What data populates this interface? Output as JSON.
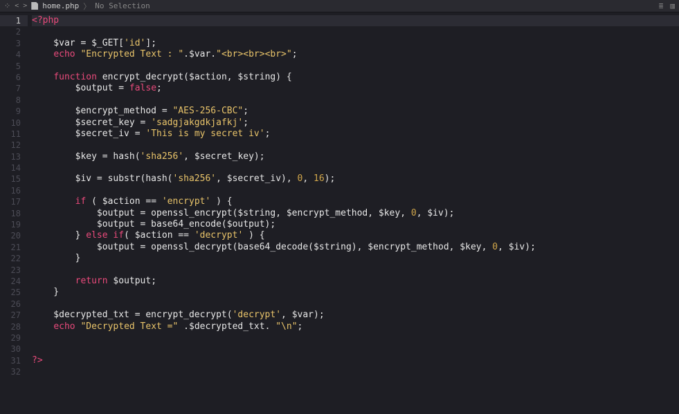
{
  "topbar": {
    "file_name": "home.php",
    "selection": "No Selection",
    "separator": "〉"
  },
  "active_line": 1,
  "lines": [
    [
      {
        "c": "t-tag",
        "t": "<?php"
      }
    ],
    [],
    [
      {
        "c": "t-misc",
        "t": "    $var = $_GET["
      },
      {
        "c": "t-idx",
        "t": "'id'"
      },
      {
        "c": "t-misc",
        "t": "];"
      }
    ],
    [
      {
        "c": "t-misc",
        "t": "    "
      },
      {
        "c": "t-key",
        "t": "echo"
      },
      {
        "c": "t-misc",
        "t": " "
      },
      {
        "c": "t-str",
        "t": "\"Encrypted Text : \""
      },
      {
        "c": "t-misc",
        "t": ".$var."
      },
      {
        "c": "t-str",
        "t": "\"<br><br><br>\""
      },
      {
        "c": "t-misc",
        "t": ";"
      }
    ],
    [],
    [
      {
        "c": "t-misc",
        "t": "    "
      },
      {
        "c": "t-key",
        "t": "function"
      },
      {
        "c": "t-misc",
        "t": " encrypt_decrypt($action, $string) {"
      }
    ],
    [
      {
        "c": "t-misc",
        "t": "        $output = "
      },
      {
        "c": "t-key",
        "t": "false"
      },
      {
        "c": "t-misc",
        "t": ";"
      }
    ],
    [],
    [
      {
        "c": "t-misc",
        "t": "        $encrypt_method = "
      },
      {
        "c": "t-str",
        "t": "\"AES-256-CBC\""
      },
      {
        "c": "t-misc",
        "t": ";"
      }
    ],
    [
      {
        "c": "t-misc",
        "t": "        $secret_key = "
      },
      {
        "c": "t-str",
        "t": "'sadgjakgdkjafkj'"
      },
      {
        "c": "t-misc",
        "t": ";"
      }
    ],
    [
      {
        "c": "t-misc",
        "t": "        $secret_iv = "
      },
      {
        "c": "t-str",
        "t": "'This is my secret iv'"
      },
      {
        "c": "t-misc",
        "t": ";"
      }
    ],
    [],
    [
      {
        "c": "t-misc",
        "t": "        $key = hash("
      },
      {
        "c": "t-str",
        "t": "'sha256'"
      },
      {
        "c": "t-misc",
        "t": ", $secret_key);"
      }
    ],
    [],
    [
      {
        "c": "t-misc",
        "t": "        $iv = substr(hash("
      },
      {
        "c": "t-str",
        "t": "'sha256'"
      },
      {
        "c": "t-misc",
        "t": ", $secret_iv), "
      },
      {
        "c": "t-numlit",
        "t": "0"
      },
      {
        "c": "t-misc",
        "t": ", "
      },
      {
        "c": "t-numlit",
        "t": "16"
      },
      {
        "c": "t-misc",
        "t": ");"
      }
    ],
    [],
    [
      {
        "c": "t-misc",
        "t": "        "
      },
      {
        "c": "t-key",
        "t": "if"
      },
      {
        "c": "t-misc",
        "t": " ( $action == "
      },
      {
        "c": "t-str",
        "t": "'encrypt'"
      },
      {
        "c": "t-misc",
        "t": " ) {"
      }
    ],
    [
      {
        "c": "t-misc",
        "t": "            $output = openssl_encrypt($string, $encrypt_method, $key, "
      },
      {
        "c": "t-numlit",
        "t": "0"
      },
      {
        "c": "t-misc",
        "t": ", $iv);"
      }
    ],
    [
      {
        "c": "t-misc",
        "t": "            $output = base64_encode($output);"
      }
    ],
    [
      {
        "c": "t-misc",
        "t": "        } "
      },
      {
        "c": "t-key",
        "t": "else if"
      },
      {
        "c": "t-misc",
        "t": "( $action == "
      },
      {
        "c": "t-str",
        "t": "'decrypt'"
      },
      {
        "c": "t-misc",
        "t": " ) {"
      }
    ],
    [
      {
        "c": "t-misc",
        "t": "            $output = openssl_decrypt(base64_decode($string), $encrypt_method, $key, "
      },
      {
        "c": "t-numlit",
        "t": "0"
      },
      {
        "c": "t-misc",
        "t": ", $iv);"
      }
    ],
    [
      {
        "c": "t-misc",
        "t": "        }"
      }
    ],
    [],
    [
      {
        "c": "t-misc",
        "t": "        "
      },
      {
        "c": "t-key",
        "t": "return"
      },
      {
        "c": "t-misc",
        "t": " $output;"
      }
    ],
    [
      {
        "c": "t-misc",
        "t": "    }"
      }
    ],
    [],
    [
      {
        "c": "t-misc",
        "t": "    $decrypted_txt = encrypt_decrypt("
      },
      {
        "c": "t-str",
        "t": "'decrypt'"
      },
      {
        "c": "t-misc",
        "t": ", $var);"
      }
    ],
    [
      {
        "c": "t-misc",
        "t": "    "
      },
      {
        "c": "t-key",
        "t": "echo"
      },
      {
        "c": "t-misc",
        "t": " "
      },
      {
        "c": "t-str",
        "t": "\"Decrypted Text =\""
      },
      {
        "c": "t-misc",
        "t": " .$decrypted_txt. "
      },
      {
        "c": "t-str",
        "t": "\"\\n\""
      },
      {
        "c": "t-misc",
        "t": ";"
      }
    ],
    [],
    [],
    [
      {
        "c": "t-tag",
        "t": "?>"
      }
    ],
    []
  ]
}
